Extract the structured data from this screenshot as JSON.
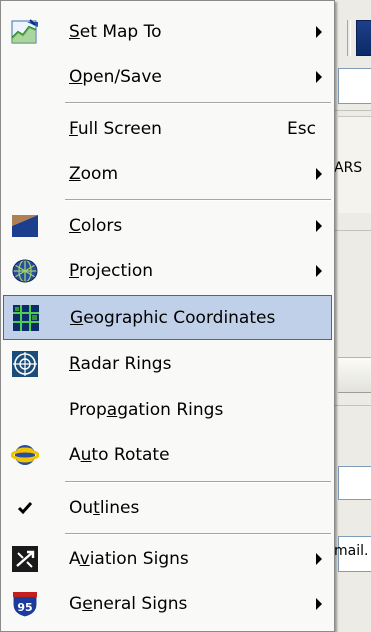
{
  "background": {
    "peek_text_1": "ARS",
    "peek_text_2": "mail."
  },
  "menu": {
    "items": [
      {
        "label": "Set Map To",
        "mnemonic": "S",
        "icon": "map-chart-icon",
        "submenu": true
      },
      {
        "label": "Open/Save",
        "mnemonic": "O",
        "icon": null,
        "submenu": true
      },
      {
        "label": "Full Screen",
        "mnemonic": "F",
        "icon": null,
        "shortcut": "Esc"
      },
      {
        "label": "Zoom",
        "mnemonic": "Z",
        "icon": null,
        "submenu": true
      },
      {
        "label": "Colors",
        "mnemonic": "C",
        "icon": "colors-icon",
        "submenu": true
      },
      {
        "label": "Projection",
        "mnemonic": "P",
        "icon": "globe-projection-icon",
        "submenu": true
      },
      {
        "label": "Geographic Coordinates",
        "mnemonic": "G",
        "icon": "grid-icon",
        "highlighted": true
      },
      {
        "label": "Radar Rings",
        "mnemonic": "R",
        "icon": "radar-icon"
      },
      {
        "label": "Propagation Rings",
        "mnemonic": "a",
        "icon": null
      },
      {
        "label": "Auto Rotate",
        "mnemonic": "u",
        "icon": "rotate-globe-icon"
      },
      {
        "label": "Outlines",
        "mnemonic": "t",
        "icon": "checkmark-icon",
        "checked": true
      },
      {
        "label": "Aviation Signs",
        "mnemonic": "v",
        "icon": "aviation-sign-icon",
        "submenu": true
      },
      {
        "label": "General Signs",
        "mnemonic": "e",
        "icon": "highway-95-icon",
        "submenu": true
      }
    ],
    "highway_number": "95"
  },
  "colors": {
    "highlight_bg": "#c0d0e8",
    "highlight_border": "#3169c6",
    "menu_bg": "#f9f9f7"
  }
}
